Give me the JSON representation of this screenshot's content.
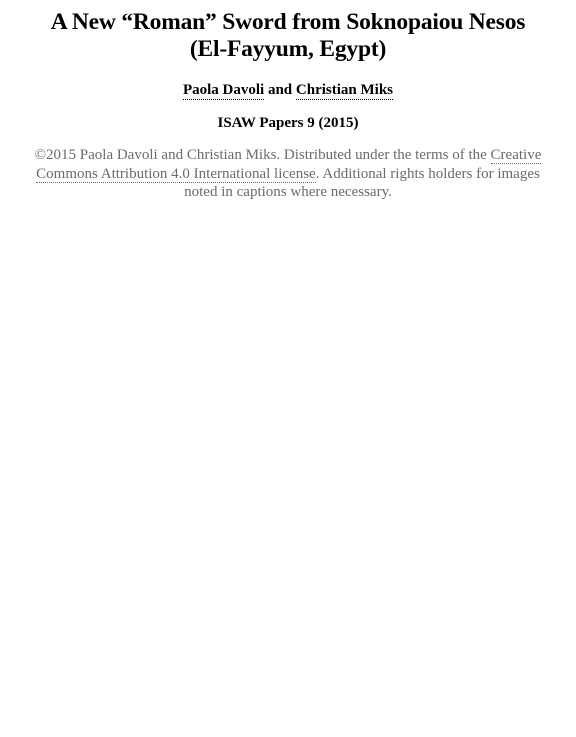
{
  "title": {
    "line1": "A New “Roman” Sword from Soknopaiou Nesos",
    "line2": "(El-Fayyum, Egypt)"
  },
  "authors": {
    "author1": "Paola Davoli",
    "conjunction": " and ",
    "author2": "Christian Miks"
  },
  "series": "ISAW Papers 9 (2015)",
  "license": {
    "prefix": "©2015 Paola Davoli and Christian Miks. Distributed under the terms of the ",
    "link_text": "Creative Commons Attribution 4.0 International license",
    "suffix": ". Additional rights holders for images noted in captions where necessary."
  }
}
